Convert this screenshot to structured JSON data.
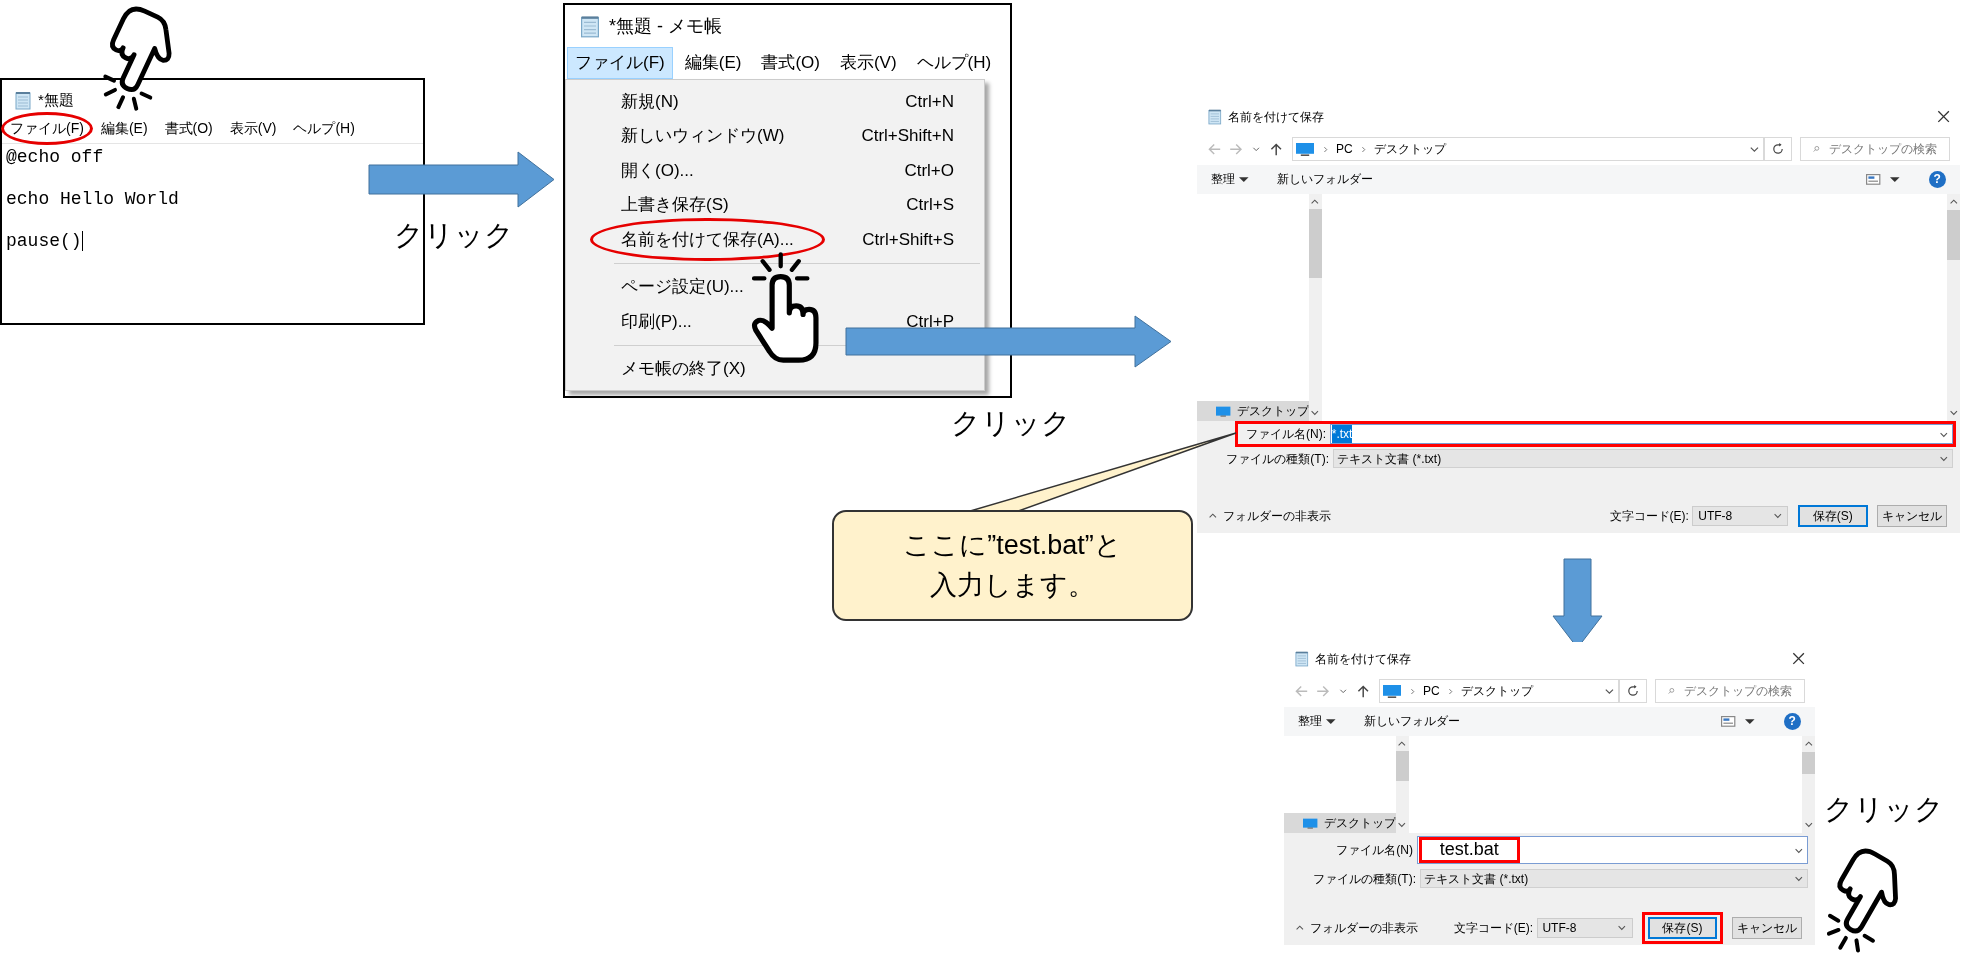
{
  "notepad": {
    "title": "*無題",
    "menu": [
      {
        "label": "ファイル(F)",
        "circled": true
      },
      {
        "label": "編集(E)",
        "circled": false
      },
      {
        "label": "書式(O)",
        "circled": false
      },
      {
        "label": "表示(V)",
        "circled": false
      },
      {
        "label": "ヘルプ(H)",
        "circled": false
      }
    ],
    "lines": [
      "@echo off",
      "echo Hello World",
      "pause()"
    ]
  },
  "menu_window": {
    "title": "*無題 - メモ帳",
    "menu": [
      {
        "label": "ファイル(F)",
        "selected": true
      },
      {
        "label": "編集(E)",
        "selected": false
      },
      {
        "label": "書式(O)",
        "selected": false
      },
      {
        "label": "表示(V)",
        "selected": false
      },
      {
        "label": "ヘルプ(H)",
        "selected": false
      }
    ],
    "items": [
      {
        "kind": "item",
        "label": "新規(N)",
        "shortcut": "Ctrl+N",
        "circled": false
      },
      {
        "kind": "item",
        "label": "新しいウィンドウ(W)",
        "shortcut": "Ctrl+Shift+N",
        "circled": false
      },
      {
        "kind": "item",
        "label": "開く(O)...",
        "shortcut": "Ctrl+O",
        "circled": false
      },
      {
        "kind": "item",
        "label": "上書き保存(S)",
        "shortcut": "Ctrl+S",
        "circled": false
      },
      {
        "kind": "item",
        "label": "名前を付けて保存(A)...",
        "shortcut": "Ctrl+Shift+S",
        "circled": true
      },
      {
        "kind": "separator"
      },
      {
        "kind": "item",
        "label": "ページ設定(U)...",
        "circled": false
      },
      {
        "kind": "item",
        "label": "印刷(P)...",
        "shortcut": "Ctrl+P",
        "circled": false
      },
      {
        "kind": "separator"
      },
      {
        "kind": "item",
        "label": "メモ帳の終了(X)",
        "circled": false
      }
    ]
  },
  "click_labels": [
    "クリック",
    "クリック",
    "クリック"
  ],
  "callout": {
    "lines": [
      "ここに”test.bat”と",
      "入力します。"
    ]
  },
  "dialogs": [
    {
      "title": "名前を付けて保存",
      "address": [
        "PC",
        "デスクトップ"
      ],
      "search_placeholder": "デスクトップの検索",
      "organize": "整理",
      "new_folder": "新しいフォルダー",
      "help": "?",
      "nav_item": "デスクトップ",
      "filename": {
        "label": "ファイル名(N):",
        "value": "*.txt",
        "value_selected": true,
        "highlight_row": true,
        "highlight_value": false
      },
      "filetype": {
        "label": "ファイルの種類(T):",
        "value": "テキスト文書 (*.txt)"
      },
      "hide_folders": "フォルダーの非表示",
      "encoding": {
        "label": "文字コード(E):",
        "value": "UTF-8"
      },
      "save_button": {
        "label": "保存(S)",
        "highlighted": false
      },
      "cancel_button": "キャンセル"
    },
    {
      "title": "名前を付けて保存",
      "address": [
        "PC",
        "デスクトップ"
      ],
      "search_placeholder": "デスクトップの検索",
      "organize": "整理",
      "new_folder": "新しいフォルダー",
      "help": "?",
      "nav_item": "デスクトップ",
      "filename": {
        "label": "ファイル名(N)",
        "value": "test.bat",
        "value_selected": false,
        "highlight_row": false,
        "highlight_value": true
      },
      "filetype": {
        "label": "ファイルの種類(T):",
        "value": "テキスト文書 (*.txt)"
      },
      "hide_folders": "フォルダーの非表示",
      "encoding": {
        "label": "文字コード(E):",
        "value": "UTF-8"
      },
      "save_button": {
        "label": "保存(S)",
        "highlighted": true
      },
      "cancel_button": "キャンセル"
    }
  ]
}
